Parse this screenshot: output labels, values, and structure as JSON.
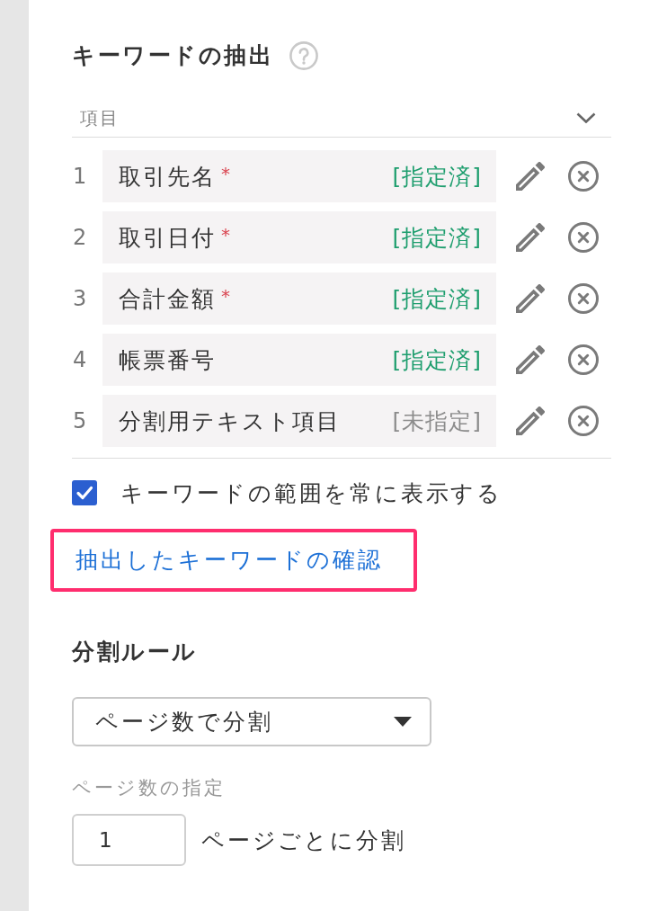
{
  "keyword_extraction": {
    "title": "キーワードの抽出",
    "column_header": "項目",
    "items": [
      {
        "number": "1",
        "name": "取引先名",
        "required_mark": "*",
        "status": "[指定済]",
        "assigned": true
      },
      {
        "number": "2",
        "name": "取引日付",
        "required_mark": "*",
        "status": "[指定済]",
        "assigned": true
      },
      {
        "number": "3",
        "name": "合計金額",
        "required_mark": "*",
        "status": "[指定済]",
        "assigned": true
      },
      {
        "number": "4",
        "name": "帳票番号",
        "status": "[指定済]",
        "assigned": true
      },
      {
        "number": "5",
        "name": "分割用テキスト項目",
        "status": "[未指定]",
        "assigned": false
      }
    ],
    "checkbox": {
      "label": "キーワードの範囲を常に表示する",
      "checked": true
    },
    "link": {
      "text": "抽出したキーワードの確認",
      "highlighted": true
    }
  },
  "split_rule": {
    "title": "分割ルール",
    "dropdown": {
      "value": "ページ数で分割"
    },
    "page_count": {
      "label": "ページ数の指定",
      "value": "1",
      "suffix": "ページごとに分割"
    }
  }
}
